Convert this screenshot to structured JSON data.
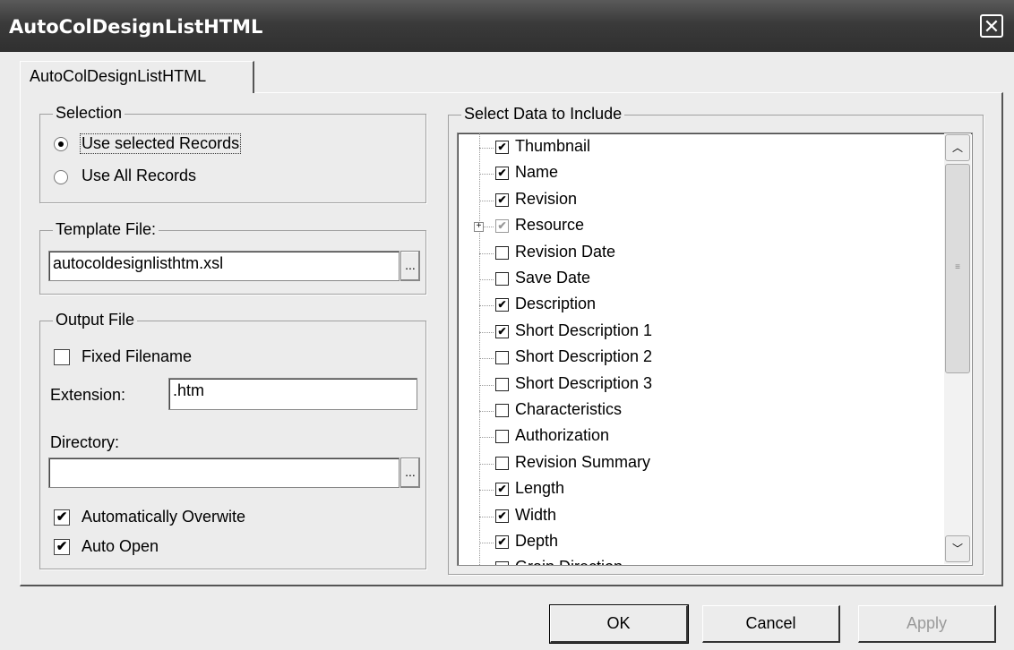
{
  "window": {
    "title": "AutoColDesignListHTML",
    "close_label": "✕"
  },
  "tab": {
    "label": "AutoColDesignListHTML"
  },
  "selection": {
    "legend": "Selection",
    "options": [
      {
        "label": "Use selected Records",
        "selected": true
      },
      {
        "label": "Use All Records",
        "selected": false
      }
    ]
  },
  "template": {
    "legend": "Template File:",
    "value": "autocoldesignlisthtm.xsl",
    "browse_label": "..."
  },
  "output": {
    "legend": "Output File",
    "fixed_filename_label": "Fixed Filename",
    "fixed_filename_checked": false,
    "extension_label": "Extension:",
    "extension_value": ".htm",
    "directory_label": "Directory:",
    "directory_value": "",
    "browse_label": "...",
    "overwrite_label": "Automatically Overwite",
    "overwrite_checked": true,
    "autoopen_label": "Auto Open",
    "autoopen_checked": true
  },
  "data_select": {
    "legend": "Select Data to Include",
    "items": [
      {
        "label": "Thumbnail",
        "checked": true
      },
      {
        "label": "Name",
        "checked": true
      },
      {
        "label": "Revision",
        "checked": true
      },
      {
        "label": "Resource",
        "checked": true,
        "gray": true,
        "expandable": true
      },
      {
        "label": "Revision Date",
        "checked": false
      },
      {
        "label": "Save Date",
        "checked": false
      },
      {
        "label": "Description",
        "checked": true
      },
      {
        "label": "Short Description 1",
        "checked": true
      },
      {
        "label": "Short Description 2",
        "checked": false
      },
      {
        "label": "Short Description 3",
        "checked": false
      },
      {
        "label": "Characteristics",
        "checked": false
      },
      {
        "label": "Authorization",
        "checked": false
      },
      {
        "label": "Revision Summary",
        "checked": false
      },
      {
        "label": "Length",
        "checked": true
      },
      {
        "label": "Width",
        "checked": true
      },
      {
        "label": "Depth",
        "checked": true
      },
      {
        "label": "Grain Direction",
        "checked": false
      }
    ]
  },
  "buttons": {
    "ok": "OK",
    "cancel": "Cancel",
    "apply": "Apply"
  }
}
